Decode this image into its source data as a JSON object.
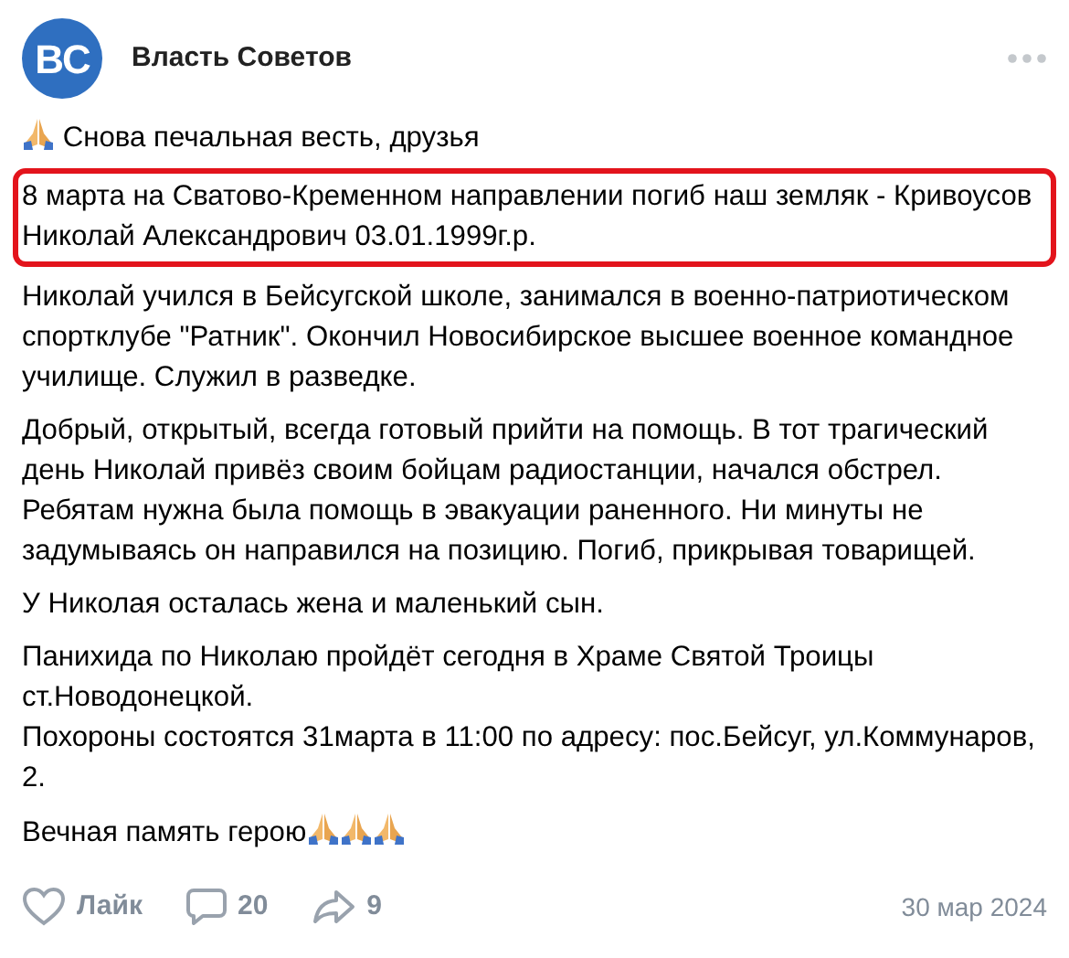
{
  "post": {
    "author": "Власть Советов",
    "logo_text": "BC",
    "paragraphs": [
      {
        "kind": "lead",
        "text": "Снова печальная весть, друзья",
        "highlighted": false
      },
      {
        "kind": "plain",
        "text": "8 марта на Сватово-Кременном направлении погиб наш земляк - Кривоусов Николай Александрович 03.01.1999г.р.",
        "highlighted": true
      },
      {
        "kind": "plain",
        "text": "Николай учился в Бейсугской школе, занимался в военно-патриотическом спортклубе \"Ратник\". Окончил Новосибирское высшее военное командное училище. Служил в разведке.",
        "highlighted": false
      },
      {
        "kind": "plain",
        "text": "Добрый, открытый, всегда готовый прийти на помощь. В тот трагический день Николай привёз своим бойцам радиостанции, начался обстрел. Ребятам нужна была помощь в эвакуации раненного. Ни минуты не задумываясь он направился на позицию. Погиб, прикрывая товарищей.",
        "highlighted": false
      },
      {
        "kind": "plain",
        "text": "У Николая осталась жена и маленький сын.",
        "highlighted": false
      },
      {
        "kind": "plain",
        "text": "Панихида по Николаю пройдёт сегодня в Храме Святой Троицы ст.Новодонецкой.\nПохороны состоятся 31марта в 11:00 по адресу: пос.Бейсуг, ул.Коммунаров, 2.",
        "highlighted": false
      },
      {
        "kind": "closing",
        "text": "Вечная память герою",
        "highlighted": false
      }
    ],
    "footer": {
      "like_label": "Лайк",
      "liked": false,
      "comments": "20",
      "shares": "9",
      "date": "30 мар 2024"
    }
  }
}
